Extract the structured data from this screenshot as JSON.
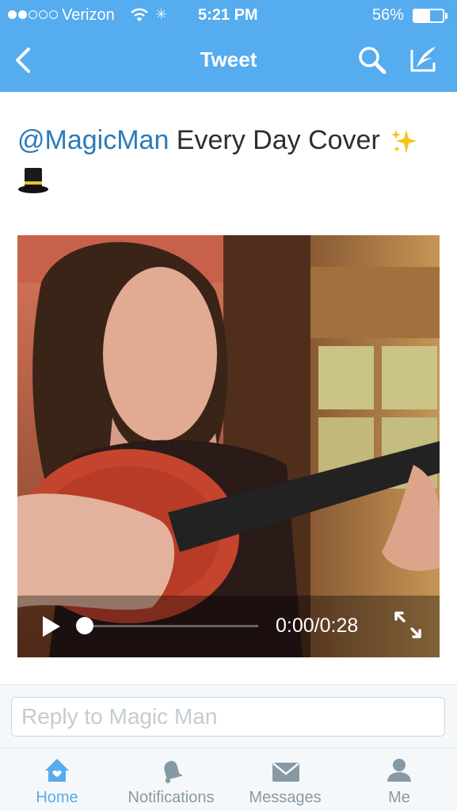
{
  "status_bar": {
    "carrier": "Verizon",
    "time": "5:21 PM",
    "battery_percent": "56%",
    "battery_level": 0.56,
    "signal_bars_filled": 2,
    "signal_bars_total": 5
  },
  "nav": {
    "title": "Tweet",
    "back_icon": "chevron-left-icon",
    "search_icon": "search-icon",
    "compose_icon": "compose-icon"
  },
  "tweet": {
    "mention": "@MagicMan",
    "text": " Every Day Cover ",
    "emojis": [
      "sparkles",
      "top-hat"
    ]
  },
  "video": {
    "current_time": "0:00",
    "separator": "/",
    "duration": "0:28",
    "progress": 0.0
  },
  "reply": {
    "placeholder": "Reply to Magic Man",
    "value": ""
  },
  "tabs": [
    {
      "label": "Home",
      "icon": "home-icon",
      "active": true
    },
    {
      "label": "Notifications",
      "icon": "bell-icon",
      "active": false
    },
    {
      "label": "Messages",
      "icon": "envelope-icon",
      "active": false
    },
    {
      "label": "Me",
      "icon": "person-icon",
      "active": false
    }
  ],
  "colors": {
    "accent": "#55acee",
    "link": "#2b7bb9",
    "tab_inactive": "#8899a6"
  }
}
